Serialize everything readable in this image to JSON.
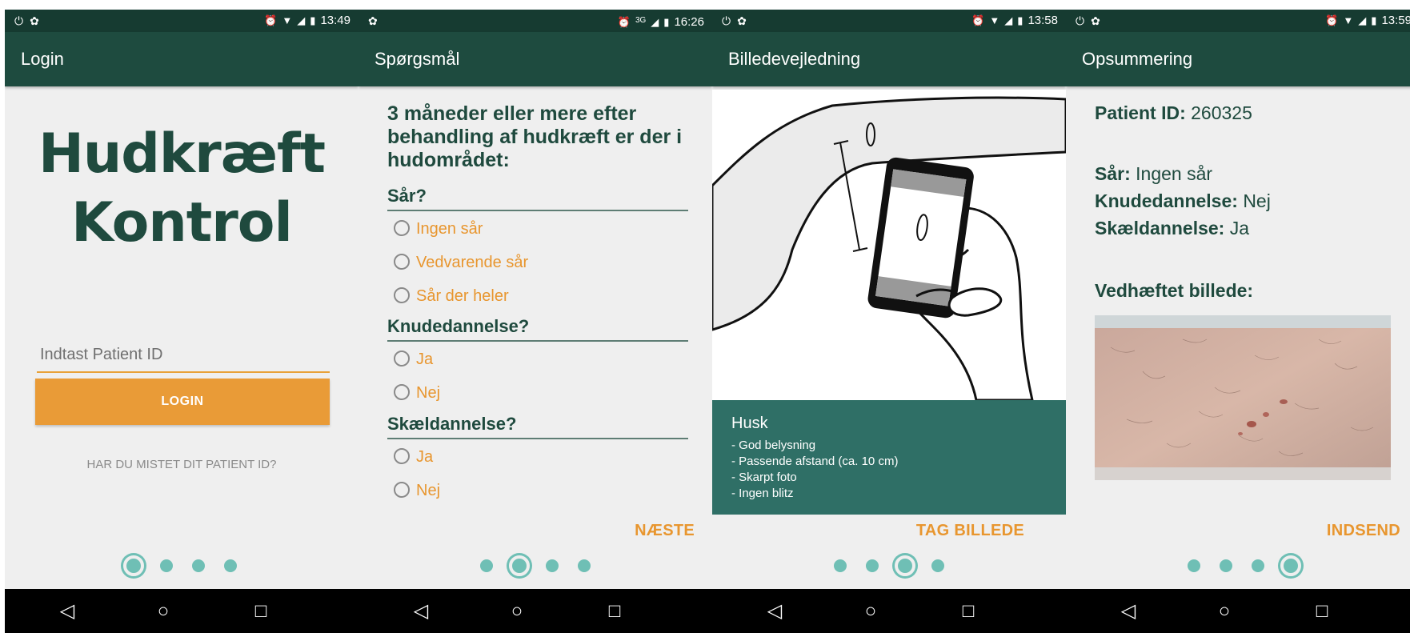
{
  "status": {
    "s1_time": "13:49",
    "s2_time": "16:26",
    "s3_time": "13:58",
    "s4_time": "13:59",
    "s2_network": "3G"
  },
  "screens": {
    "login": {
      "title": "Login",
      "brand_line1": "Hudkræft",
      "brand_line2": "Kontrol",
      "pid_placeholder": "Indtast Patient ID",
      "login_label": "LOGIN",
      "lost_label": "HAR DU MISTET DIT PATIENT ID?"
    },
    "questions": {
      "title": "Spørgsmål",
      "intro": "3 måneder eller mere efter behandling af hudkræft er der i hudområdet:",
      "sections": [
        {
          "label": "Sår?",
          "options": [
            "Ingen sår",
            "Vedvarende sår",
            "Sår der heler"
          ]
        },
        {
          "label": "Knudedannelse?",
          "options": [
            "Ja",
            "Nej"
          ]
        },
        {
          "label": "Skældannelse?",
          "options": [
            "Ja",
            "Nej"
          ]
        }
      ],
      "next_label": "NÆSTE"
    },
    "guide": {
      "title": "Billedevejledning",
      "husk_title": "Husk",
      "husk_items": [
        "- God belysning",
        "- Passende afstand (ca. 10 cm)",
        "- Skarpt foto",
        "- Ingen blitz"
      ],
      "action_label": "TAG BILLEDE"
    },
    "summary": {
      "title": "Opsummering",
      "patient_label": "Patient ID:",
      "patient_value": "260325",
      "sar_label": "Sår:",
      "sar_value": "Ingen sår",
      "knude_label": "Knudedannelse:",
      "knude_value": "Nej",
      "skael_label": "Skældannelse:",
      "skael_value": "Ja",
      "attached_label": "Vedhæftet billede:",
      "submit_label": "INDSEND"
    }
  },
  "pager": {
    "total_steps": 4
  },
  "colors": {
    "appbar": "#1e4b3f",
    "statusbar": "#163b31",
    "accent_orange": "#e99b37",
    "dot_teal": "#6fbfb5",
    "husk_box": "#2f6f66",
    "heading_green": "#1f4a3e"
  }
}
